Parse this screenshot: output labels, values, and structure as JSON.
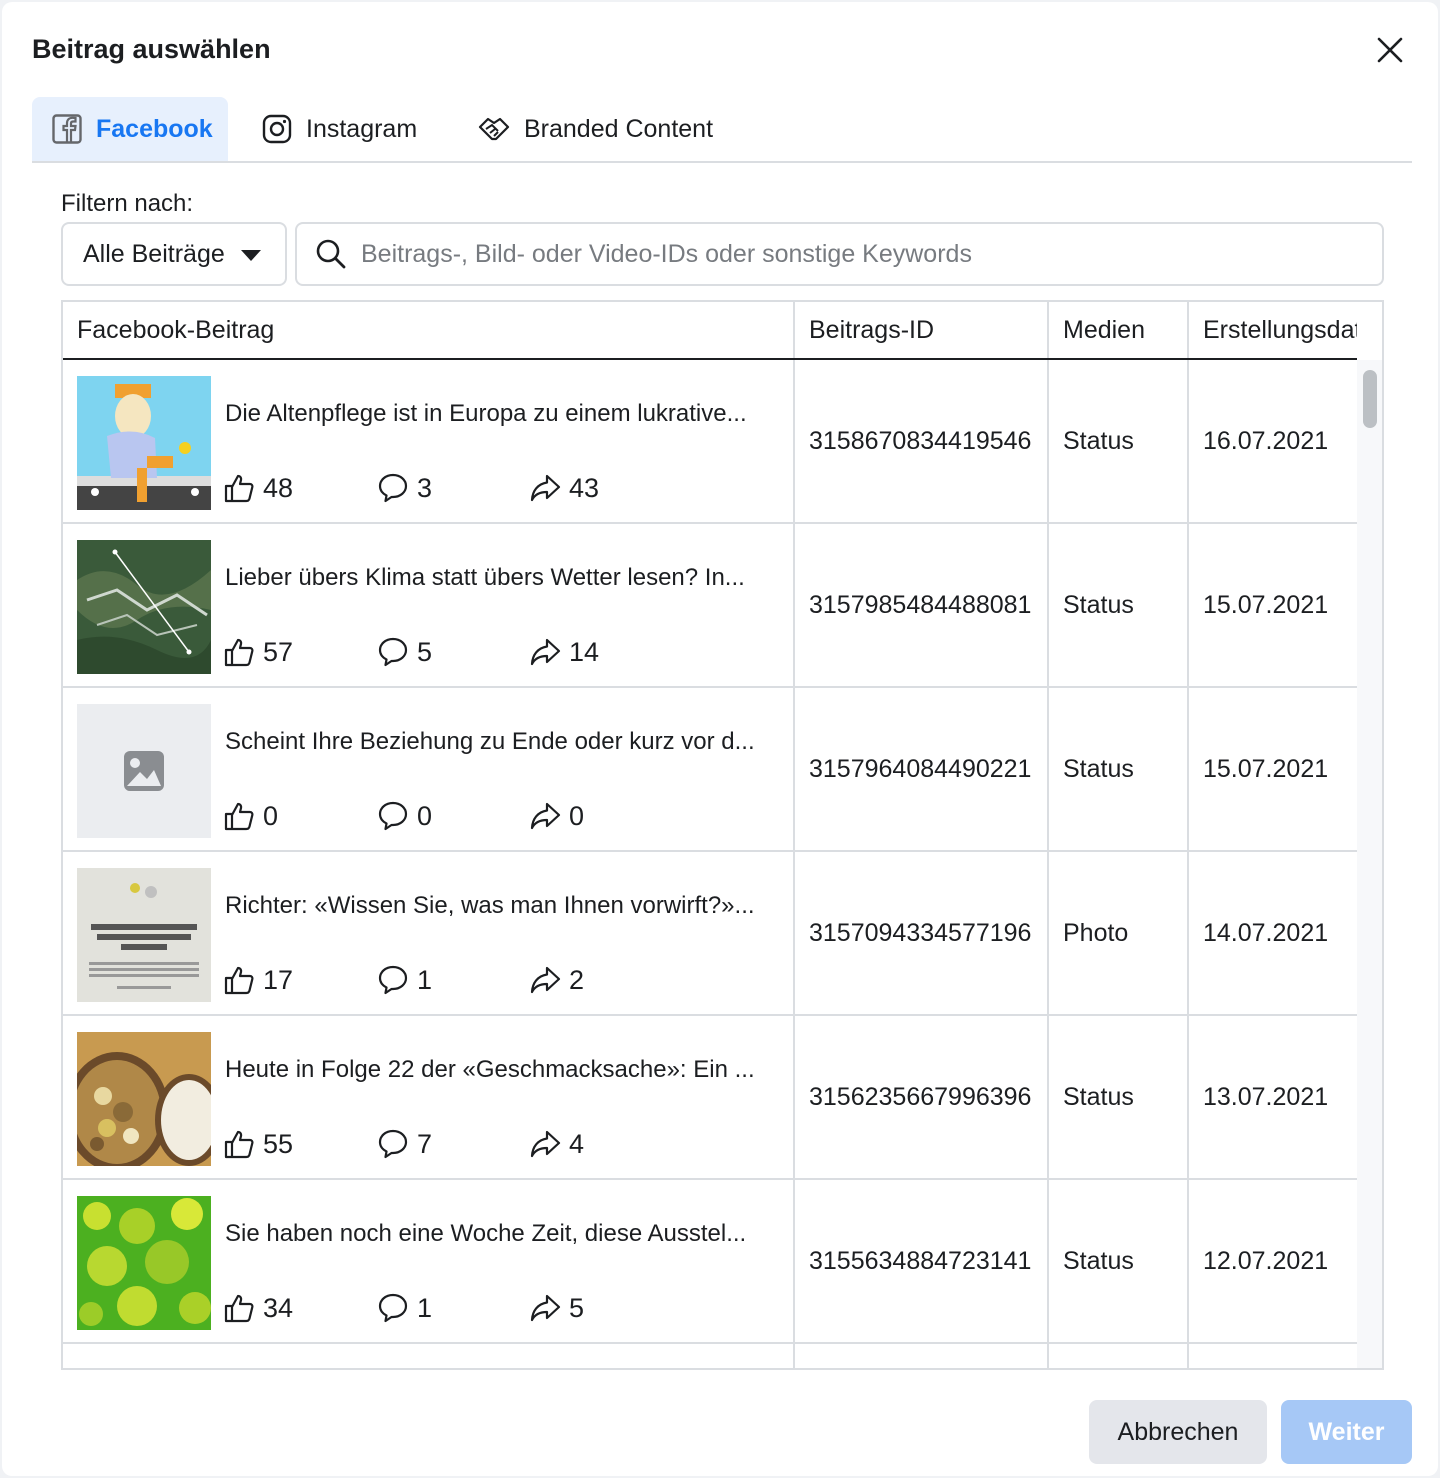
{
  "dialog": {
    "title": "Beitrag auswählen",
    "close_icon": "close-icon"
  },
  "tabs": [
    {
      "label": "Facebook",
      "icon": "facebook-icon",
      "active": true
    },
    {
      "label": "Instagram",
      "icon": "instagram-icon",
      "active": false
    },
    {
      "label": "Branded Content",
      "icon": "handshake-icon",
      "active": false
    }
  ],
  "filter": {
    "label": "Filtern nach:",
    "dropdown_value": "Alle Beiträge",
    "search_placeholder": "Beitrags-, Bild- oder Video-IDs oder sonstige Keywords"
  },
  "table": {
    "columns": [
      "Facebook-Beitrag",
      "Beitrags-ID",
      "Medien",
      "Erstellungsdatum"
    ],
    "rows": [
      {
        "text": "Die Altenpflege ist in Europa zu einem lukrative...",
        "likes": "48",
        "comments": "3",
        "shares": "43",
        "id": "3158670834419546",
        "media": "Status",
        "date": "16.07.2021"
      },
      {
        "text": "Lieber übers Klima statt übers Wetter lesen? In...",
        "likes": "57",
        "comments": "5",
        "shares": "14",
        "id": "3157985484488081",
        "media": "Status",
        "date": "15.07.2021"
      },
      {
        "text": "Scheint Ihre Beziehung zu Ende oder kurz vor d...",
        "likes": "0",
        "comments": "0",
        "shares": "0",
        "id": "3157964084490221",
        "media": "Status",
        "date": "15.07.2021"
      },
      {
        "text": "Richter: «Wissen Sie, was man Ihnen vorwirft?»...",
        "likes": "17",
        "comments": "1",
        "shares": "2",
        "id": "3157094334577196",
        "media": "Photo",
        "date": "14.07.2021"
      },
      {
        "text": "Heute in Folge 22 der «Geschmacksache»: Ein ...",
        "likes": "55",
        "comments": "7",
        "shares": "4",
        "id": "3156235667996396",
        "media": "Status",
        "date": "13.07.2021"
      },
      {
        "text": "Sie haben noch eine Woche Zeit, diese Ausstel...",
        "likes": "34",
        "comments": "1",
        "shares": "5",
        "id": "3155634884723141",
        "media": "Status",
        "date": "12.07.2021"
      }
    ]
  },
  "footer": {
    "cancel_label": "Abbrechen",
    "next_label": "Weiter"
  },
  "colors": {
    "accent": "#1877f2",
    "tab_active_bg": "#e7f0fd",
    "next_disabled": "#a6c8f6"
  }
}
